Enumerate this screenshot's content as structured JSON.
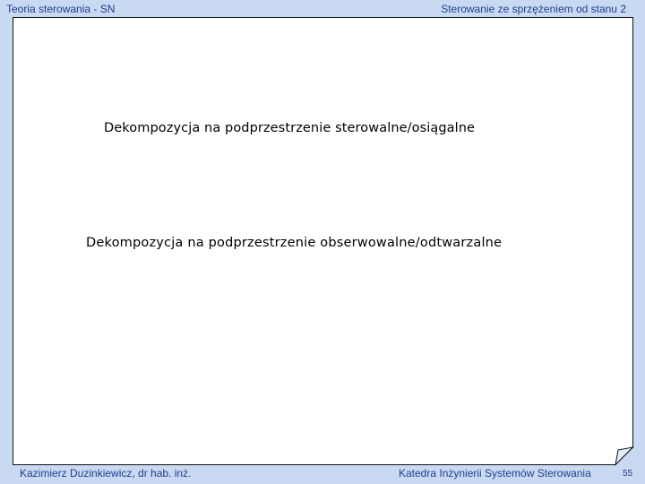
{
  "header": {
    "course_title": "Teoria sterowania - SN",
    "lecture_title": "Sterowanie ze sprzężeniem od stanu 2"
  },
  "content": {
    "heading_1": "Dekompozycja na podprzestrzenie sterowalne/osiągalne",
    "heading_2": "Dekompozycja na podprzestrzenie obserwowalne/odtwarzalne"
  },
  "footer": {
    "author": "Kazimierz Duzinkiewicz, dr hab. inż.",
    "department": "Katedra Inżynierii Systemów Sterowania",
    "page_number": "55"
  },
  "colors": {
    "background": "#c9d9f1",
    "sheet": "#ffffff",
    "header_text": "#1f3f8f"
  }
}
